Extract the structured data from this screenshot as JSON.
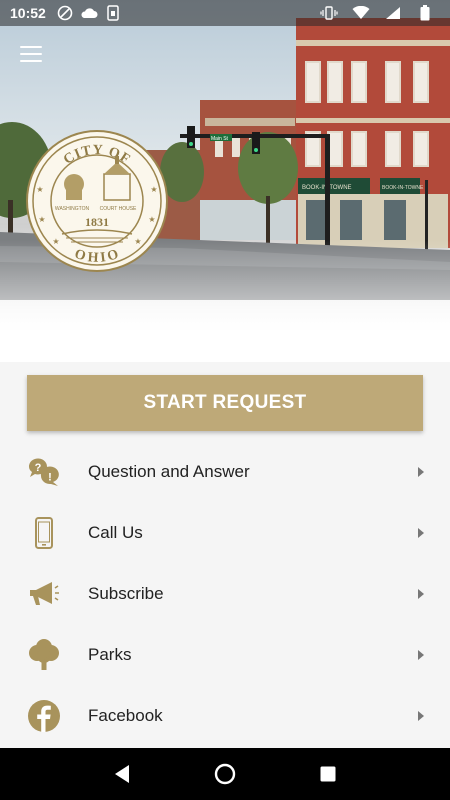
{
  "status_bar": {
    "time": "10:52",
    "left_icons": [
      "no-disturb-icon",
      "cloud-icon",
      "sim-icon"
    ],
    "right_icons": [
      "vibrate-icon",
      "wifi-icon",
      "signal-icon",
      "battery-icon"
    ]
  },
  "seal": {
    "top_text": "CITY OF",
    "bottom_text": "OHIO",
    "left_label": "WASHINGTON",
    "right_label": "COURT HOUSE",
    "year": "1831"
  },
  "street_signs": [
    "Main St"
  ],
  "store_signs": [
    "BOOK-IN-TOWNE",
    "BOOK-IN-TOWNE"
  ],
  "start_button": {
    "label": "START REQUEST"
  },
  "menu": {
    "items": [
      {
        "label": "Question and Answer",
        "icon": "question-answer-icon"
      },
      {
        "label": "Call Us",
        "icon": "phone-icon"
      },
      {
        "label": "Subscribe",
        "icon": "megaphone-icon"
      },
      {
        "label": "Parks",
        "icon": "tree-icon"
      },
      {
        "label": "Facebook",
        "icon": "facebook-icon"
      }
    ]
  },
  "colors": {
    "accent": "#bea978",
    "icon": "#a8935c",
    "text": "#222222",
    "background": "#f5f5f5"
  }
}
